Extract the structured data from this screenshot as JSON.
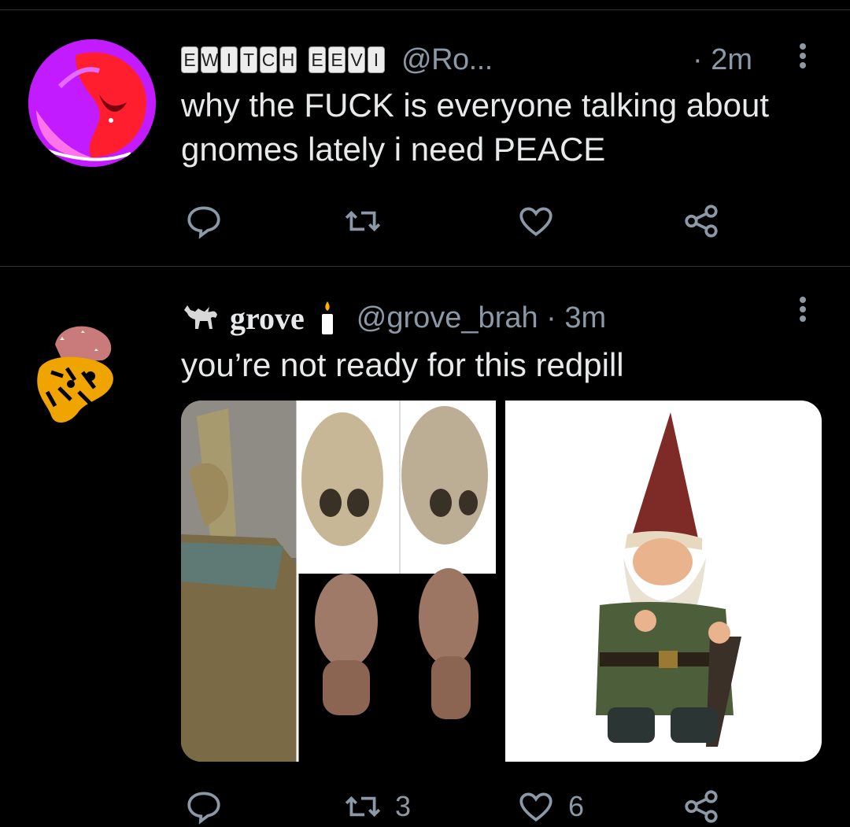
{
  "tweet1": {
    "display_name_keys_a": [
      "E",
      "W",
      "I",
      "T",
      "C",
      "H"
    ],
    "display_name_keys_b": [
      "E",
      "E",
      "V",
      "I"
    ],
    "handle": "@Ro...",
    "time": "· 2m",
    "text_line1": "why the FUCK is everyone talking about",
    "text_line2": "gnomes lately i need PEACE",
    "avatar_colors": {
      "base": "#c21bff",
      "accent": "#ff2a2a"
    }
  },
  "tweet2": {
    "name": "grove",
    "handle": "@grove_brah · 3m",
    "text": "you’re not ready for this redpill",
    "retweets": "3",
    "likes": "6",
    "media": [
      {
        "desc": "collage of elongated skulls and statues"
      },
      {
        "desc": "garden gnome statue"
      }
    ]
  },
  "icons": [
    "reply-icon",
    "retweet-icon",
    "like-icon",
    "share-icon",
    "more-icon"
  ],
  "colors": {
    "background": "#000000",
    "text": "#e7e9ea",
    "muted": "#8b98a5",
    "divider": "#2f3336"
  }
}
